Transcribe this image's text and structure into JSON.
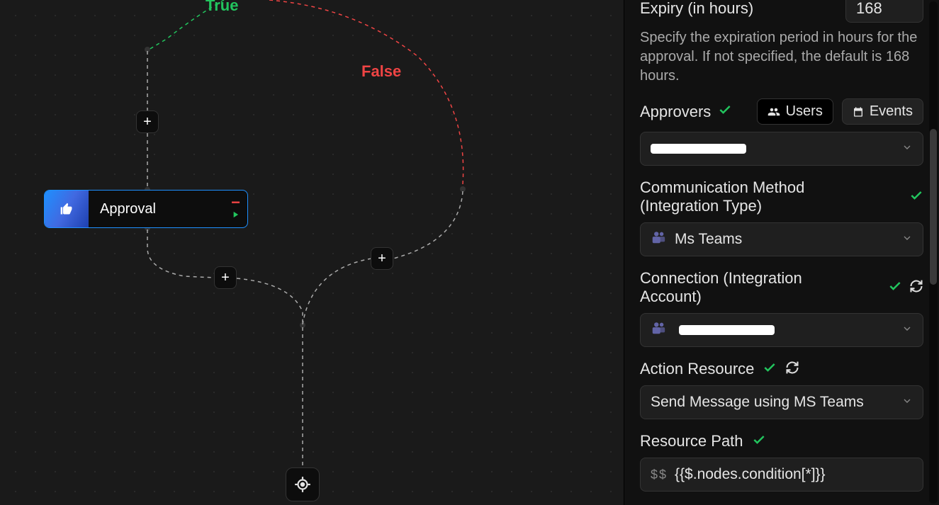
{
  "canvas": {
    "trueLabel": "True",
    "falseLabel": "False",
    "approvalNode": {
      "label": "Approval"
    }
  },
  "sidebar": {
    "expiry": {
      "label": "Expiry (in hours)",
      "value": "168",
      "help": "Specify the expiration period in hours for the approval. If not specified, the default is 168 hours."
    },
    "approvers": {
      "label": "Approvers",
      "usersTab": "Users",
      "eventsTab": "Events",
      "value": ""
    },
    "commMethod": {
      "label": "Communication Method (Integration Type)",
      "value": "Ms Teams"
    },
    "connection": {
      "label": "Connection (Integration Account)",
      "value": ""
    },
    "actionResource": {
      "label": "Action Resource",
      "value": "Send Message using MS Teams"
    },
    "resourcePath": {
      "label": "Resource Path",
      "prefix": "$$",
      "value": "{{$.nodes.condition[*]}}"
    }
  }
}
